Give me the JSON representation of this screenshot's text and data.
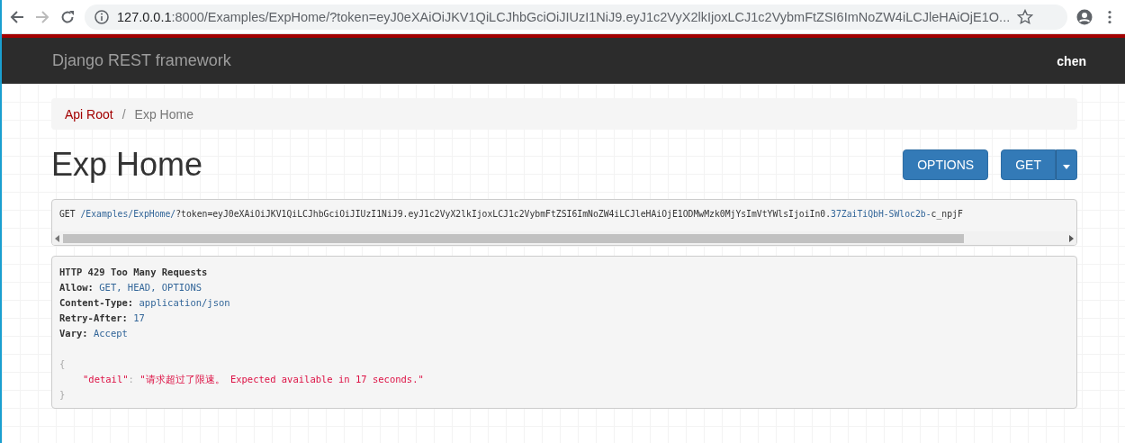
{
  "browser": {
    "host": "127.0.0.1",
    "address_rest": ":8000/Examples/ExpHome/?token=eyJ0eXAiOiJKV1QiLCJhbGciOiJIUzI1NiJ9.eyJ1c2VyX2lkIjoxLCJ1c2VybmFtZSI6ImNoZW4iLCJleHAiOjE1O..."
  },
  "navbar": {
    "brand": "Django REST framework",
    "user": "chen"
  },
  "breadcrumb_separator": "/",
  "breadcrumb": [
    {
      "label": "Api Root",
      "selected": false
    },
    {
      "label": "Exp Home",
      "selected": true
    }
  ],
  "title": "Exp Home",
  "buttons": [
    {
      "label": "OPTIONS",
      "kind": "plain"
    },
    {
      "label": "GET",
      "kind": "split"
    }
  ],
  "request": {
    "method": "GET",
    "path": "/Examples/ExpHome/",
    "query": "?token=eyJ0eXAiOiJKV1QiLCJhbGciOiJIUzI1NiJ9.eyJ1c2VyX2lkIjoxLCJ1c2VybmFtZSI6ImNoZW4iLCJleHAiOjE1ODMwMzk0MjYsImVtYWlsIjoiIn0.",
    "signature": "37ZaiTiQbH-SWloc2b-",
    "tail": "c_npjF"
  },
  "response": {
    "status": "HTTP 429 Too Many Requests",
    "headers": [
      {
        "name": "Allow:",
        "value": "GET, HEAD, OPTIONS"
      },
      {
        "name": "Content-Type:",
        "value": "application/json"
      },
      {
        "name": "Retry-After:",
        "value": "17"
      },
      {
        "name": "Vary:",
        "value": "Accept"
      }
    ],
    "open_brace": "{",
    "key": "\"detail\"",
    "colon": ":",
    "value": "\"请求超过了限速。 Expected available in 17 seconds.\"",
    "close_brace": "}"
  }
}
